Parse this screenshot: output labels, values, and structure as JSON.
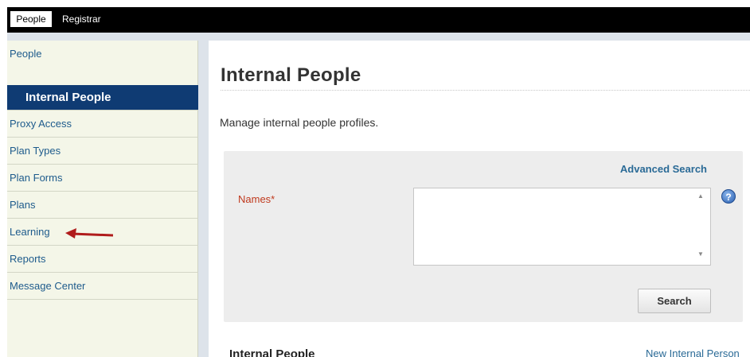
{
  "top_nav": {
    "active": "People",
    "other": "Registrar"
  },
  "sidebar": {
    "header": "People",
    "items": [
      {
        "label": "Internal People",
        "selected": true
      },
      {
        "label": "Proxy Access"
      },
      {
        "label": "Plan Types"
      },
      {
        "label": "Plan Forms"
      },
      {
        "label": "Plans"
      },
      {
        "label": "Learning"
      },
      {
        "label": "Reports"
      },
      {
        "label": "Message Center"
      }
    ]
  },
  "main": {
    "title": "Internal People",
    "description": "Manage internal people profiles.",
    "search": {
      "advanced_link": "Advanced Search",
      "names_label": "Names*",
      "names_value": "",
      "help_icon": "question-mark-icon",
      "button_label": "Search"
    },
    "results": {
      "section_title": "Internal People",
      "new_link": "New Internal Person"
    }
  },
  "annotation": {
    "arrow_target": "Learning",
    "arrow_color": "#b01c1c"
  },
  "colors": {
    "selected_bg": "#0f3b73",
    "link": "#2a6a96",
    "required_label": "#c03a1e",
    "sidebar_bg": "#f4f6e8"
  }
}
